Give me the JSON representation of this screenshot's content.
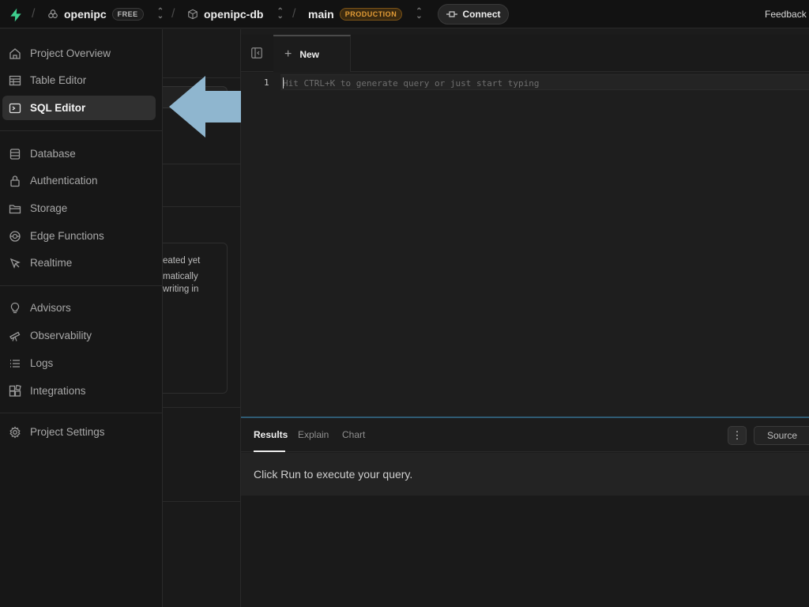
{
  "topbar": {
    "org_name": "openipc",
    "org_plan_badge": "FREE",
    "project_name": "openipc-db",
    "branch_name": "main",
    "branch_badge": "PRODUCTION",
    "connect_label": "Connect",
    "feedback_label": "Feedback",
    "separator": "/"
  },
  "sidebar": {
    "items": [
      {
        "label": "Project Overview",
        "icon": "home-icon"
      },
      {
        "label": "Table Editor",
        "icon": "table-icon"
      },
      {
        "label": "SQL Editor",
        "icon": "terminal-icon",
        "active": true
      },
      {
        "label": "Database",
        "icon": "database-icon"
      },
      {
        "label": "Authentication",
        "icon": "lock-icon"
      },
      {
        "label": "Storage",
        "icon": "storage-icon"
      },
      {
        "label": "Edge Functions",
        "icon": "edge-functions-icon"
      },
      {
        "label": "Realtime",
        "icon": "cursor-icon"
      },
      {
        "label": "Advisors",
        "icon": "lightbulb-icon"
      },
      {
        "label": "Observability",
        "icon": "telescope-icon"
      },
      {
        "label": "Logs",
        "icon": "list-icon"
      },
      {
        "label": "Integrations",
        "icon": "integrations-icon"
      },
      {
        "label": "Project Settings",
        "icon": "gear-icon"
      }
    ]
  },
  "midpanel": {
    "card_line1": "eated yet",
    "card_line2": "matically",
    "card_line3": "writing in"
  },
  "editor": {
    "tab_label": "New",
    "line_number": "1",
    "placeholder": "Hit CTRL+K to generate query or just start typing"
  },
  "results": {
    "tabs": [
      "Results",
      "Explain",
      "Chart"
    ],
    "active_tab": "Results",
    "more_label": "⋮",
    "source_label": "Source",
    "message": "Click Run to execute your query."
  },
  "colors": {
    "accent_green": "#3ecf8e",
    "production_badge": "#e39c36",
    "arrow_fill": "#8fb6cf"
  }
}
